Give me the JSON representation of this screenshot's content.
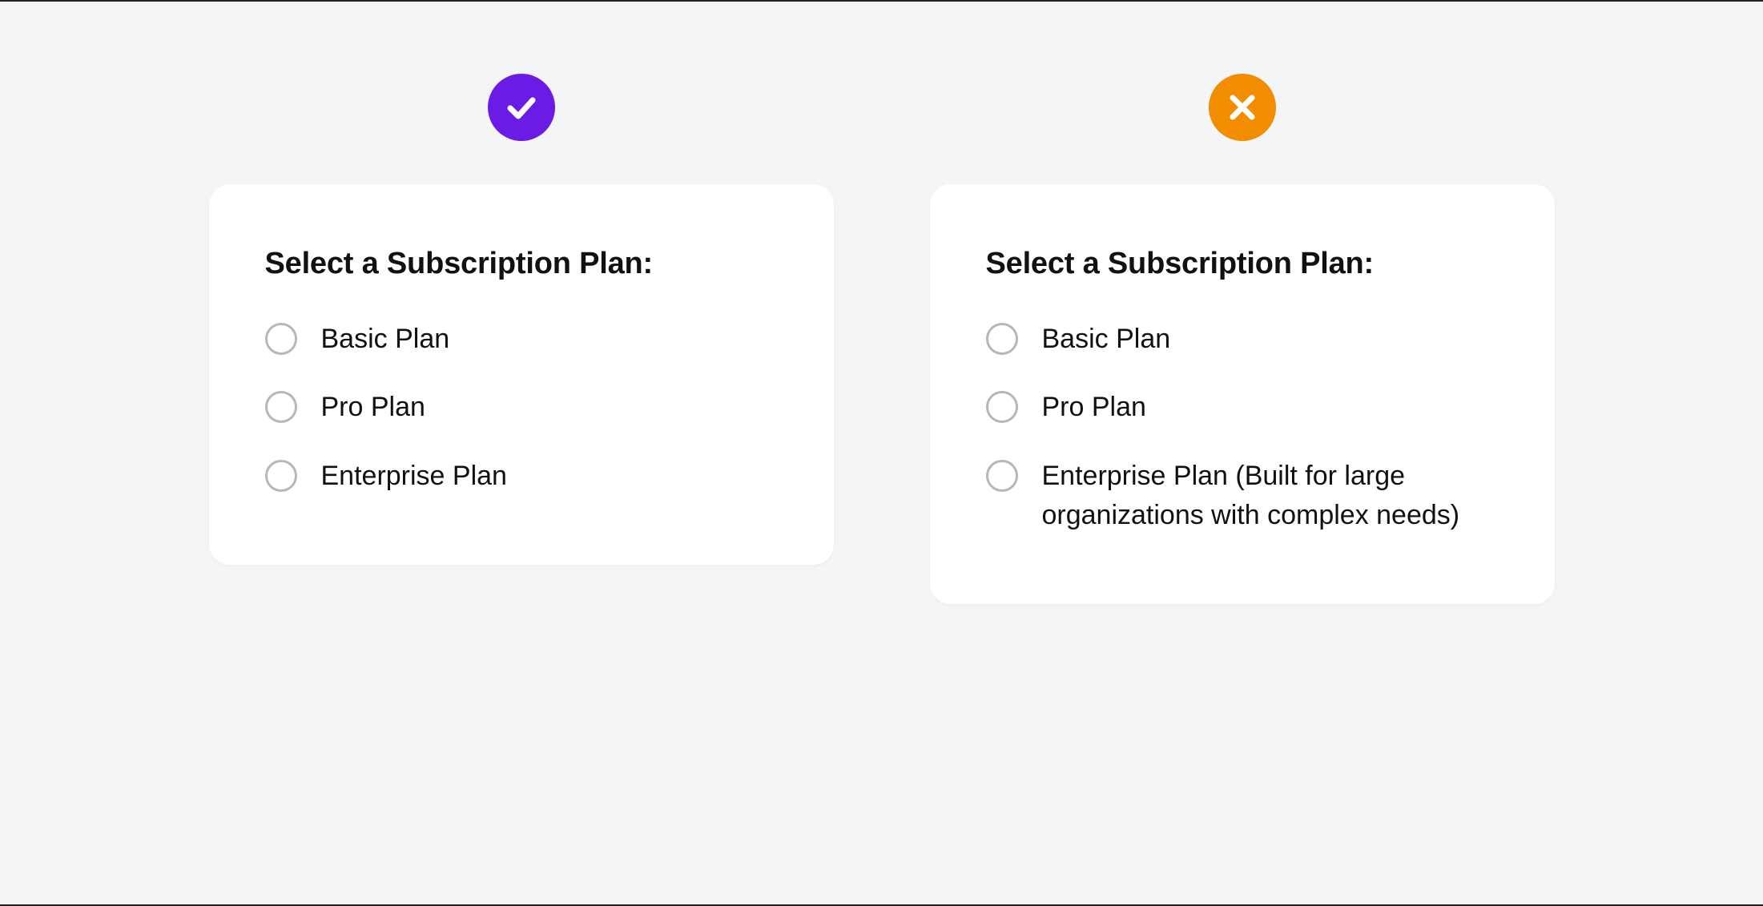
{
  "good": {
    "badge_color": "#6a1be6",
    "title": "Select a Subscription Plan:",
    "options": [
      {
        "label": "Basic Plan"
      },
      {
        "label": "Pro Plan"
      },
      {
        "label": "Enterprise Plan"
      }
    ]
  },
  "bad": {
    "badge_color": "#f28c00",
    "title": "Select a Subscription Plan:",
    "options": [
      {
        "label": "Basic Plan"
      },
      {
        "label": "Pro Plan"
      },
      {
        "label": "Enterprise Plan (Built for large organizations with complex needs)"
      }
    ]
  }
}
